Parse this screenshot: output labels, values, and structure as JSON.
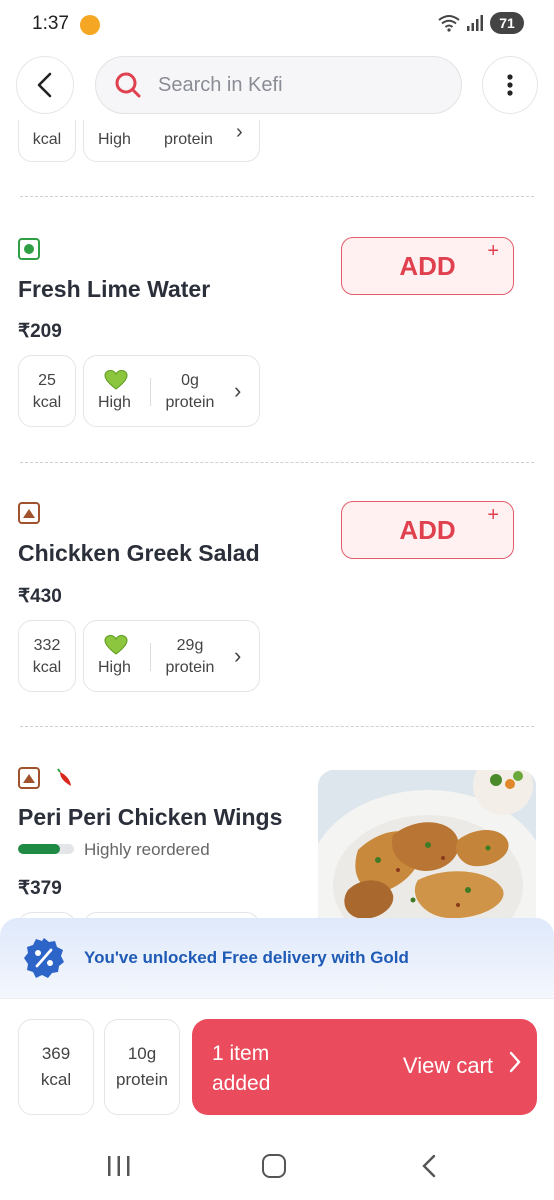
{
  "status_bar": {
    "time": "1:37",
    "battery": "71"
  },
  "header": {
    "search_placeholder": "Search in Kefi"
  },
  "partial_item": {
    "kcal_unit": "kcal",
    "high": "High",
    "protein_label": "protein"
  },
  "items": [
    {
      "name": "Fresh Lime Water",
      "price": "₹209",
      "type": "veg",
      "add_label": "ADD",
      "add_plus": "+",
      "kcal": "25",
      "kcal_unit": "kcal",
      "high": "High",
      "protein": "0g",
      "protein_label": "protein"
    },
    {
      "name": "Chickken Greek Salad",
      "price": "₹430",
      "type": "non-veg",
      "add_label": "ADD",
      "add_plus": "+",
      "kcal": "332",
      "kcal_unit": "kcal",
      "high": "High",
      "protein": "29g",
      "protein_label": "protein"
    },
    {
      "name": "Peri Peri Chicken Wings",
      "price": "₹379",
      "type": "non-veg",
      "spicy": true,
      "reorder_label": "Highly reordered",
      "reorder_level": 0.75
    }
  ],
  "gold_banner": {
    "text": "You've unlocked Free delivery with Gold"
  },
  "cart": {
    "kcal": "369",
    "kcal_unit": "kcal",
    "protein": "10g",
    "protein_label": "protein",
    "count_label": "1 item added",
    "view_label": "View cart"
  },
  "colors": {
    "accent": "#ea4c5d",
    "veg": "#2f9e44",
    "nonveg": "#a0522d",
    "gold_text": "#1f5bb5"
  },
  "icons": [
    "back-arrow-icon",
    "search-icon",
    "more-vertical-icon",
    "leaf-heart-icon",
    "chevron-right-icon",
    "chili-icon",
    "discount-badge-icon"
  ]
}
